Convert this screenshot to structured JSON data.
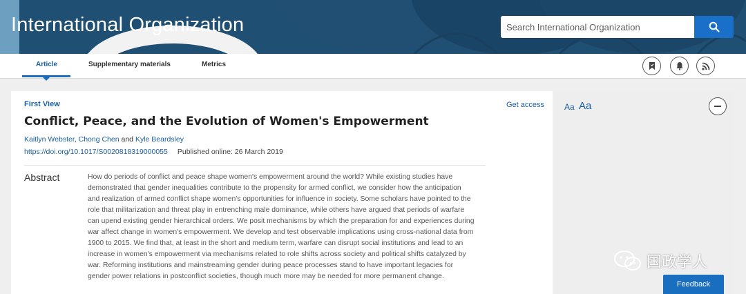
{
  "header": {
    "journal_title": "International Organization",
    "search_placeholder": "Search International Organization"
  },
  "tabs": [
    {
      "label": "Article",
      "active": true
    },
    {
      "label": "Supplementary materials",
      "active": false
    },
    {
      "label": "Metrics",
      "active": false
    }
  ],
  "toolbar_icons": [
    "bookmark-icon",
    "bell-icon",
    "rss-icon"
  ],
  "article": {
    "status": "First View",
    "access_link": "Get access",
    "title": "Conflict, Peace, and the Evolution of Women's Empowerment",
    "authors": [
      "Kaitlyn Webster",
      "Chong Chen",
      "Kyle Beardsley"
    ],
    "author_sep_1": ", ",
    "author_sep_2": " and ",
    "doi": "https://doi.org/10.1017/S0020818319000055",
    "published": "Published online: 26 March 2019",
    "abstract_heading": "Abstract",
    "abstract_text": "How do periods of conflict and peace shape women's empowerment around the world? While existing studies have demonstrated that gender inequalities contribute to the propensity for armed conflict, we consider how the anticipation and realization of armed conflict shape women's opportunities for influence in society. Some scholars have pointed to the role that militarization and threat play in entrenching male dominance, while others have argued that periods of warfare can upend existing gender hierarchical orders. We posit mechanisms by which the preparation for and experiences during war affect change in women's empowerment. We develop and test observable implications using cross-national data from 1900 to 2015. We find that, at least in the short and medium term, warfare can disrupt social institutions and lead to an increase in women's empowerment via mechanisms related to role shifts across society and political shifts catalyzed by war. Reforming institutions and mainstreaming gender during peace processes stand to have important legacies for gender power relations in postconflict societies, though much more may be needed for more permanent change."
  },
  "side_panel": {
    "font_small": "Aa",
    "font_large": "Aa"
  },
  "watermark": "国政学人",
  "feedback_label": "Feedback",
  "colors": {
    "banner": "#1f4f72",
    "accent": "#1a6ec0",
    "link": "#1a5fa3"
  }
}
